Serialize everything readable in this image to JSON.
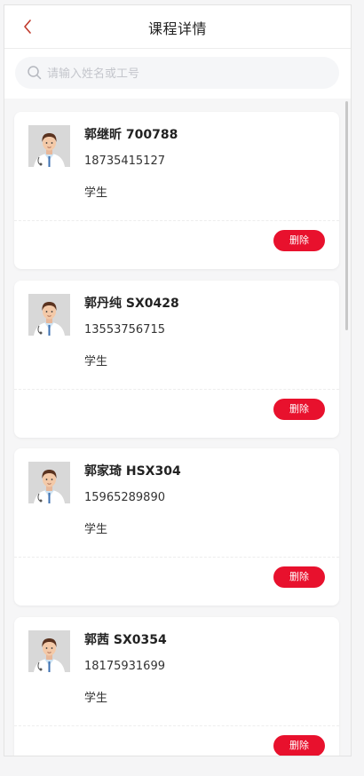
{
  "header": {
    "title": "课程详情",
    "back_icon": "chevron-left-icon"
  },
  "search": {
    "placeholder": "请输入姓名或工号",
    "icon": "search-icon"
  },
  "colors": {
    "accent": "#e8112d",
    "back_arrow": "#c0392b"
  },
  "members": [
    {
      "name": "郭继昕 700788",
      "phone": "18735415127",
      "role": "学生",
      "delete_label": "删除"
    },
    {
      "name": "郭丹纯 SX0428",
      "phone": "13553756715",
      "role": "学生",
      "delete_label": "删除"
    },
    {
      "name": "郭家琦 HSX304",
      "phone": "15965289890",
      "role": "学生",
      "delete_label": "删除"
    },
    {
      "name": "郭茜 SX0354",
      "phone": "18175931699",
      "role": "学生",
      "delete_label": "删除"
    }
  ]
}
